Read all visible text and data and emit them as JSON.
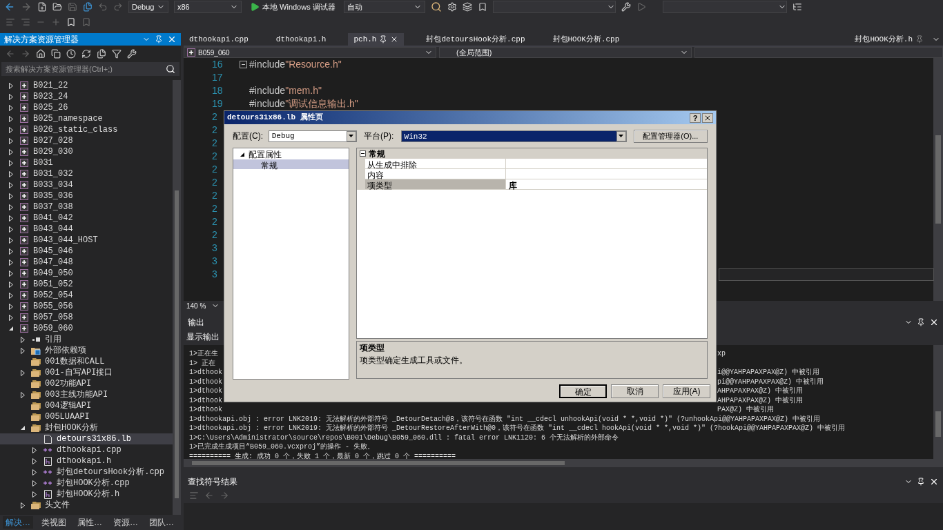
{
  "toolbar": {
    "config": "Debug",
    "platform": "x86",
    "run_label": "本地 Windows 调试器",
    "run_mode": "自动"
  },
  "solution_explorer": {
    "title": "解决方案资源管理器",
    "search": {
      "placeholder": "搜索解决方案资源管理器(Ctrl+;)"
    },
    "tree": [
      {
        "label": "B021_22",
        "kind": "project",
        "expanded": false,
        "selected": false
      },
      {
        "label": "B023_24",
        "kind": "project",
        "expanded": false,
        "selected": false
      },
      {
        "label": "B025_26",
        "kind": "project",
        "expanded": false,
        "selected": false
      },
      {
        "label": "B025_namespace",
        "kind": "project",
        "expanded": false,
        "selected": false
      },
      {
        "label": "B026_static_class",
        "kind": "project",
        "expanded": false,
        "selected": false
      },
      {
        "label": "B027_028",
        "kind": "project",
        "expanded": false,
        "selected": false
      },
      {
        "label": "B029_030",
        "kind": "project",
        "expanded": false,
        "selected": false
      },
      {
        "label": "B031",
        "kind": "project",
        "expanded": false,
        "selected": false
      },
      {
        "label": "B031_032",
        "kind": "project",
        "expanded": false,
        "selected": false
      },
      {
        "label": "B033_034",
        "kind": "project",
        "expanded": false,
        "selected": false
      },
      {
        "label": "B035_036",
        "kind": "project",
        "expanded": false,
        "selected": false
      },
      {
        "label": "B037_038",
        "kind": "project",
        "expanded": false,
        "selected": false
      },
      {
        "label": "B041_042",
        "kind": "project",
        "expanded": false,
        "selected": false
      },
      {
        "label": "B043_044",
        "kind": "project",
        "expanded": false,
        "selected": false
      },
      {
        "label": "B043_044_HOST",
        "kind": "project",
        "expanded": false,
        "selected": false
      },
      {
        "label": "B045_046",
        "kind": "project",
        "expanded": false,
        "selected": false
      },
      {
        "label": "B047_048",
        "kind": "project",
        "expanded": false,
        "selected": false
      },
      {
        "label": "B049_050",
        "kind": "project",
        "expanded": false,
        "selected": false
      },
      {
        "label": "B051_052",
        "kind": "project",
        "expanded": false,
        "selected": false
      },
      {
        "label": "B052_054",
        "kind": "project",
        "expanded": false,
        "selected": false
      },
      {
        "label": "B055_056",
        "kind": "project",
        "expanded": false,
        "selected": false
      },
      {
        "label": "B057_058",
        "kind": "project",
        "expanded": false,
        "selected": false
      },
      {
        "label": "B059_060",
        "kind": "project",
        "expanded": true,
        "selected": false,
        "children": [
          {
            "label": "引用",
            "kind": "references",
            "expanded": false,
            "selected": false
          },
          {
            "label": "外部依赖项",
            "kind": "external",
            "expanded": false,
            "selected": false
          },
          {
            "label": "001数据和CALL",
            "kind": "filter",
            "selected": false
          },
          {
            "label": "001-自写API接口",
            "kind": "filter",
            "expanded": false,
            "selected": false
          },
          {
            "label": "002功能API",
            "kind": "filter",
            "selected": false
          },
          {
            "label": "003主线功能API",
            "kind": "filter",
            "expanded": false,
            "selected": false
          },
          {
            "label": "004逻辑API",
            "kind": "filter",
            "selected": false
          },
          {
            "label": "005LUAAPI",
            "kind": "filter",
            "selected": false
          },
          {
            "label": "封包HOOK分析",
            "kind": "filter",
            "expanded": true,
            "selected": false,
            "children": [
              {
                "label": "detours31x86.lb",
                "kind": "file",
                "selected": true
              },
              {
                "label": "dthookapi.cpp",
                "kind": "cpp",
                "expanded": false,
                "selected": false
              },
              {
                "label": "dthookapi.h",
                "kind": "header",
                "expanded": false,
                "selected": false
              },
              {
                "label": "封包detoursHook分析.cpp",
                "kind": "cpp",
                "expanded": false,
                "selected": false
              },
              {
                "label": "封包HOOK分析.cpp",
                "kind": "cpp",
                "expanded": false,
                "selected": false
              },
              {
                "label": "封包HOOK分析.h",
                "kind": "header",
                "expanded": false,
                "selected": false
              }
            ]
          },
          {
            "label": "头文件",
            "kind": "filter",
            "expanded": false,
            "selected": false
          }
        ]
      }
    ],
    "bottom_tabs": [
      {
        "label": "解决…",
        "selected": true
      },
      {
        "label": "类视图",
        "selected": false
      },
      {
        "label": "属性…",
        "selected": false
      },
      {
        "label": "资源…",
        "selected": false
      },
      {
        "label": "团队…",
        "selected": false
      }
    ]
  },
  "editor": {
    "tabs": [
      {
        "label": "dthookapi.cpp",
        "selected": false
      },
      {
        "label": "dthookapi.h",
        "selected": false
      },
      {
        "label": "pch.h",
        "selected": true
      },
      {
        "label": "封包detoursHook分析.cpp",
        "selected": false
      },
      {
        "label": "封包HOOK分析.cpp",
        "selected": false
      }
    ],
    "pinned_tabs": [
      {
        "label": "封包HOOK分析.h",
        "selected": false
      }
    ],
    "project_scope": "B059_060",
    "member_scope": "(全局范围)",
    "lines": [
      {
        "number": "16",
        "collapsible": true,
        "directive": "#include",
        "target": "\"Resource.h\""
      },
      {
        "number": "17"
      },
      {
        "number": "18",
        "directive": "#include",
        "target": "\"mem.h\""
      },
      {
        "number": "19",
        "directive": "#include",
        "target": "\"调试信息输出.h\""
      },
      {
        "number": "2"
      },
      {
        "number": "2"
      },
      {
        "number": "2"
      },
      {
        "number": "2"
      },
      {
        "number": "2"
      },
      {
        "number": "2"
      },
      {
        "number": "2"
      },
      {
        "number": "2"
      },
      {
        "number": "2"
      },
      {
        "number": "2"
      },
      {
        "number": "3"
      },
      {
        "number": "3"
      },
      {
        "number": "3"
      }
    ],
    "zoom": "140 %"
  },
  "output": {
    "title": "输出",
    "source_label": "显示输出",
    "lines": [
      {
        "text": "1>正在生",
        "tail": "xp"
      },
      {
        "text": "1>  正在"
      },
      {
        "text": "1>dthook",
        "tail": "i@@YAHPAPAXPAX@Z) 中被引用"
      },
      {
        "text": "1>dthook",
        "tail": "pi@@YAHPAPAXPAX@Z) 中被引用"
      },
      {
        "text": "1>dthook",
        "tail": "AHPAPAXPAX@Z) 中被引用"
      },
      {
        "text": "1>dthook",
        "tail": "AHPAPAXPAX@Z) 中被引用"
      },
      {
        "text": "1>dthook",
        "tail": "PAX@Z) 中被引用"
      },
      {
        "text": "1>dthookapi.obj : error LNK2019: 无法解析的外部符号 _DetourDetach@8，该符号在函数 \"int __cdecl unhookApi(void * *,void *)\" (?unhookApi@@YAHPAPAXPAX@Z) 中被引用"
      },
      {
        "text": "1>dthookapi.obj : error LNK2019: 无法解析的外部符号 _DetourRestoreAfterWith@0，该符号在函数 \"int __cdecl hookApi(void * *,void *)\" (?hookApi@@YAHPAPAXPAX@Z) 中被引用"
      },
      {
        "text": "1>C:\\Users\\Administrator\\source\\repos\\B001\\Debug\\B059_060.dll : fatal error LNK1120: 6 个无法解析的外部命令"
      },
      {
        "text": "1>已完成生成项目“B059_060.vcxproj”的操作 - 失败。"
      },
      {
        "text": "========== 生成: 成功 0 个，失败 1 个，最新 0 个，跳过 0 个 =========="
      }
    ]
  },
  "symbol_results": {
    "title": "查找符号结果"
  },
  "dialog": {
    "title": "detours31x86.lb 属性页",
    "help": "?",
    "config_label": "配置(C):",
    "config_value": "Debug",
    "platform_label": "平台(P):",
    "platform_value": "Win32",
    "manager_button": "配置管理器(O)...",
    "tree": [
      {
        "label": "配置属性",
        "expanded": true,
        "selected": false,
        "children": [
          {
            "label": "常规",
            "selected": true
          }
        ]
      }
    ],
    "category": {
      "label": "常规",
      "expanded": true
    },
    "properties": [
      {
        "name": "从生成中排除",
        "selected": false
      },
      {
        "name": "内容",
        "selected": false
      },
      {
        "name": "项类型",
        "value": "库",
        "selected": true
      }
    ],
    "description": {
      "title": "项类型",
      "text": "项类型确定生成工具或文件。"
    },
    "buttons": [
      {
        "label": "确定",
        "default": true
      },
      {
        "label": "取消",
        "default": false
      },
      {
        "label": "应用(A)",
        "default": false
      }
    ]
  }
}
